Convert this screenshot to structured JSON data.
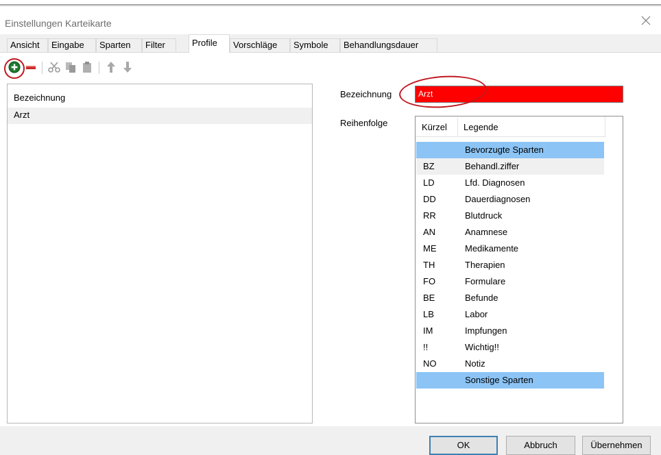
{
  "window": {
    "title": "Einstellungen Karteikarte",
    "close_glyph": "✕"
  },
  "tabs": [
    {
      "label": "Ansicht"
    },
    {
      "label": "Eingabe"
    },
    {
      "label": "Sparten"
    },
    {
      "label": "Filter"
    },
    {
      "label": "Profile",
      "active": true
    },
    {
      "label": "Vorschläge"
    },
    {
      "label": "Symbole"
    },
    {
      "label": "Behandlungsdauer"
    }
  ],
  "toolbar": {
    "buttons": [
      "add-icon",
      "remove-icon",
      "cut-icon",
      "copy-icon",
      "paste-icon",
      "move-up-icon",
      "move-down-icon"
    ],
    "colors": {
      "add": "#1f7a2e",
      "remove": "#c62828"
    }
  },
  "profile_list": {
    "header": "Bezeichnung",
    "items": [
      "Arzt"
    ]
  },
  "details": {
    "name_label": "Bezeichnung",
    "name_value": "Arzt",
    "name_field_color": "#ff0000",
    "order_label": "Reihenfolge"
  },
  "order_grid": {
    "columns": [
      "Kürzel",
      "Legende"
    ],
    "rows": [
      {
        "code": "",
        "legend": "Bevorzugte Sparten",
        "style": "blue"
      },
      {
        "code": "BZ",
        "legend": "Behandl.ziffer",
        "style": "grey"
      },
      {
        "code": "LD",
        "legend": "Lfd. Diagnosen"
      },
      {
        "code": "DD",
        "legend": "Dauerdiagnosen"
      },
      {
        "code": "RR",
        "legend": "Blutdruck"
      },
      {
        "code": "AN",
        "legend": "Anamnese"
      },
      {
        "code": "ME",
        "legend": "Medikamente"
      },
      {
        "code": "TH",
        "legend": "Therapien"
      },
      {
        "code": "FO",
        "legend": "Formulare"
      },
      {
        "code": "BE",
        "legend": "Befunde"
      },
      {
        "code": "LB",
        "legend": "Labor"
      },
      {
        "code": "IM",
        "legend": "Impfungen"
      },
      {
        "code": "!!",
        "legend": "Wichtig!!"
      },
      {
        "code": "NO",
        "legend": "Notiz"
      },
      {
        "code": "",
        "legend": "Sonstige Sparten",
        "style": "blue"
      }
    ]
  },
  "buttons": {
    "ok": "OK",
    "cancel": "Abbruch",
    "apply": "Übernehmen"
  },
  "annotation_color": "#c0171d"
}
